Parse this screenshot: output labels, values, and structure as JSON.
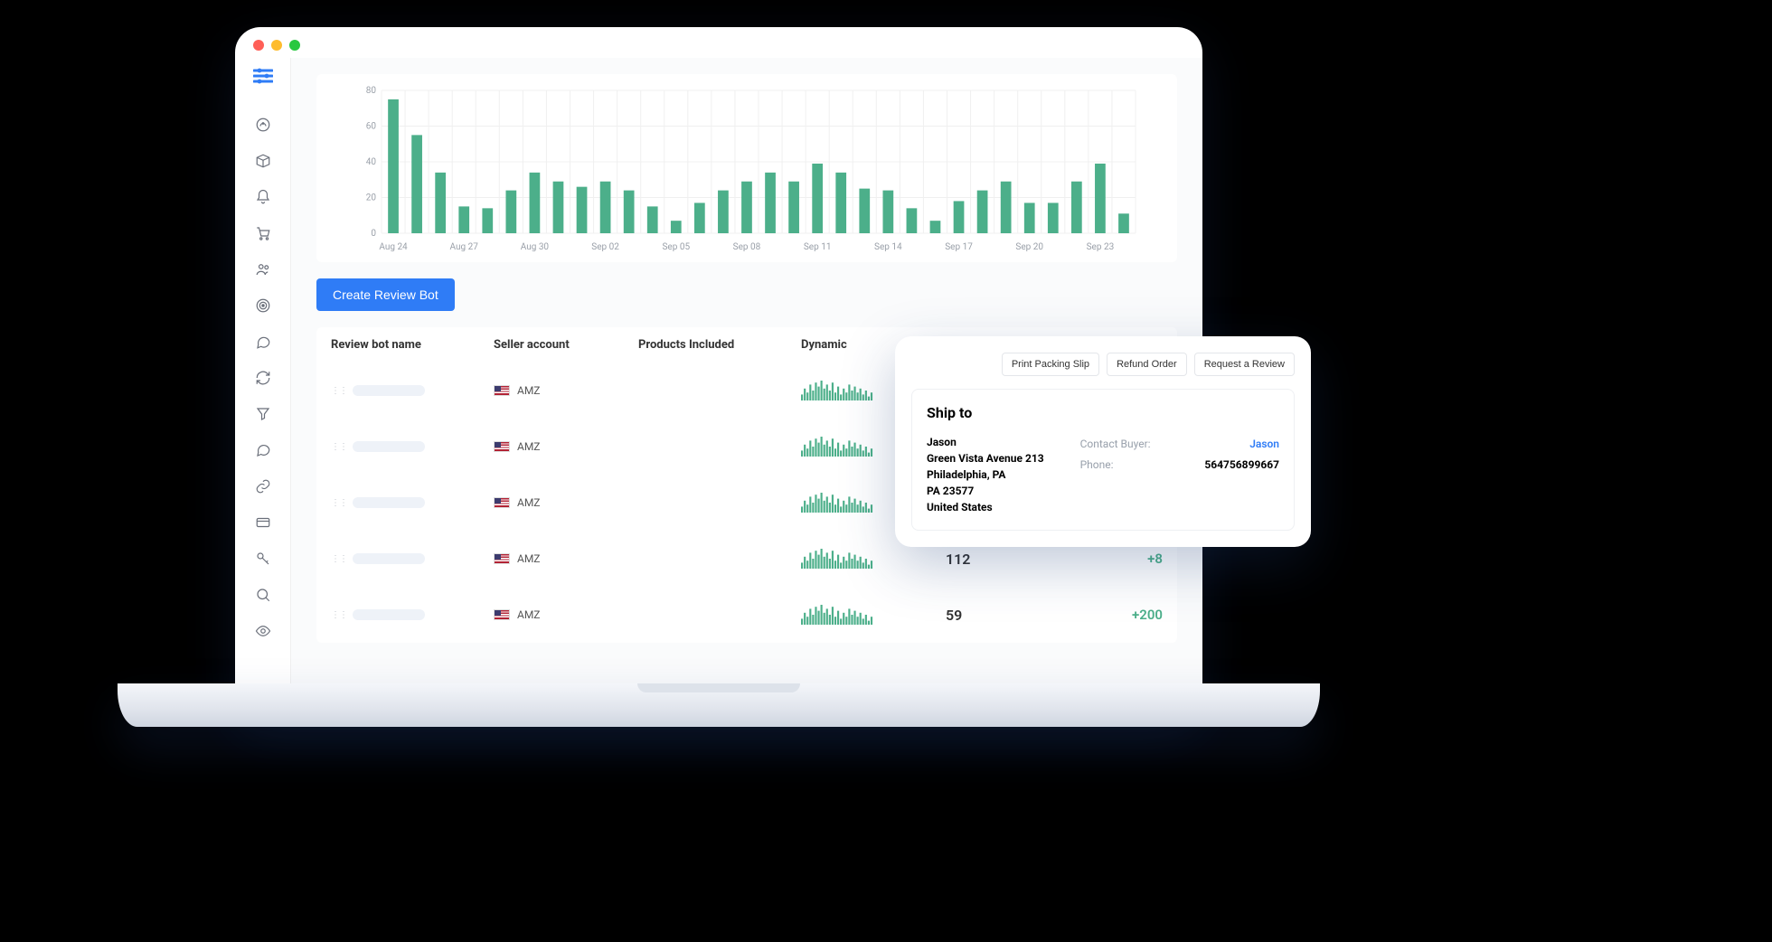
{
  "chart_data": {
    "type": "bar",
    "y_ticks": [
      0,
      20,
      40,
      60,
      80
    ],
    "ylim": [
      0,
      80
    ],
    "x_labels": [
      "Aug 24",
      "Aug 27",
      "Aug 30",
      "Sep 02",
      "Sep 05",
      "Sep 08",
      "Sep 11",
      "Sep 14",
      "Sep 17",
      "Sep 20",
      "Sep 23"
    ],
    "values": [
      75,
      55,
      34,
      15,
      14,
      24,
      34,
      29,
      26,
      29,
      24,
      15,
      7,
      17,
      24,
      29,
      34,
      29,
      39,
      34,
      25,
      24,
      14,
      7,
      18,
      24,
      29,
      17,
      17,
      29,
      39,
      11
    ]
  },
  "actions": {
    "create_review_bot": "Create Review Bot"
  },
  "table": {
    "headers": {
      "name": "Review bot name",
      "seller": "Seller account",
      "products": "Products Included",
      "dynamic": "Dynamic"
    },
    "rows": [
      {
        "seller": "AMZ",
        "value": "",
        "delta": ""
      },
      {
        "seller": "AMZ",
        "value": "",
        "delta": ""
      },
      {
        "seller": "AMZ",
        "value": "",
        "delta": ""
      },
      {
        "seller": "AMZ",
        "value": "112",
        "delta": "+8"
      },
      {
        "seller": "AMZ",
        "value": "59",
        "delta": "+200"
      }
    ]
  },
  "popup": {
    "actions": {
      "print": "Print Packing Slip",
      "refund": "Refund Order",
      "review": "Request a Review"
    },
    "title": "Ship to",
    "address": {
      "name": "Jason",
      "street": "Green Vista Avenue 213",
      "city": "Philadelphia, PA",
      "zip": "PA 23577",
      "country": "United States"
    },
    "contact": {
      "buyer_label": "Contact Buyer:",
      "buyer_name": "Jason",
      "phone_label": "Phone:",
      "phone": "564756899667"
    }
  }
}
